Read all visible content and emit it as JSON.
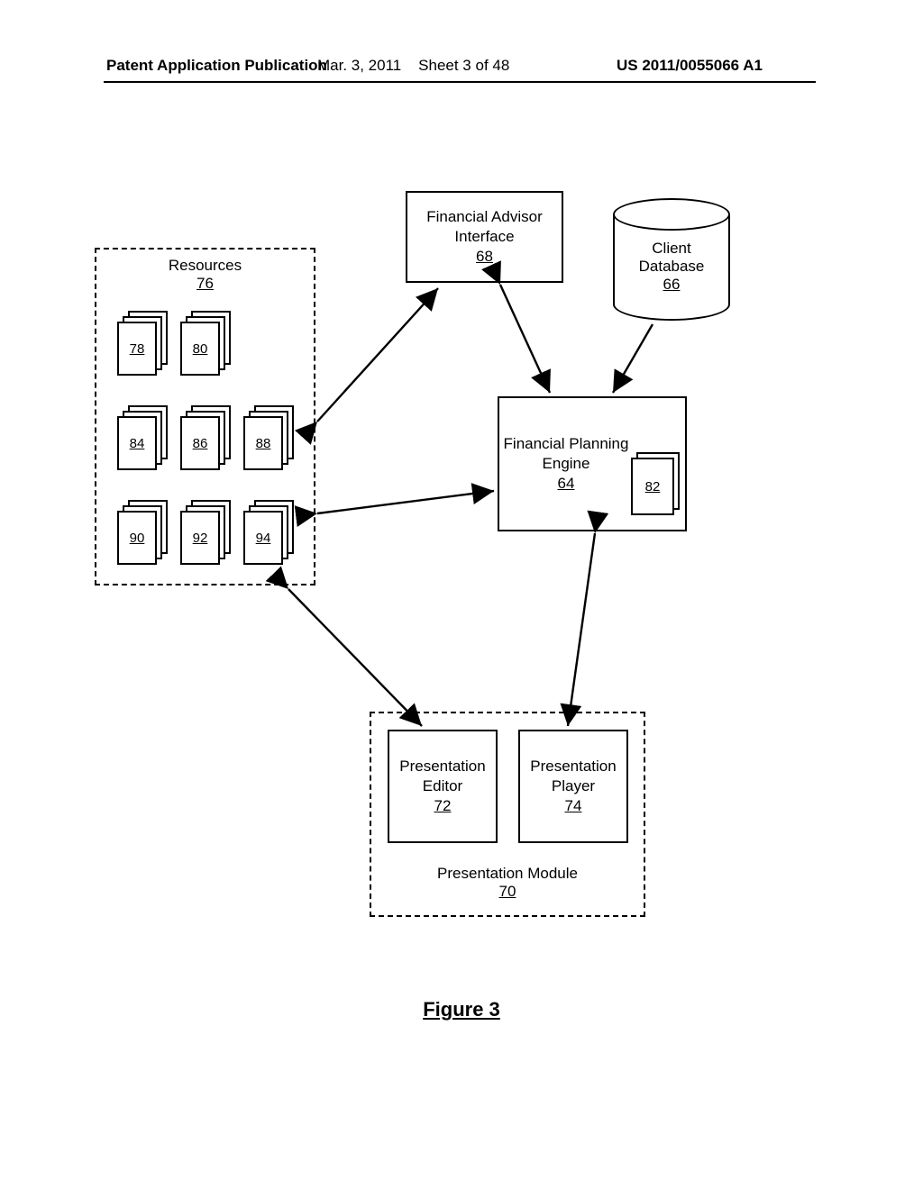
{
  "header": {
    "left": "Patent Application Publication",
    "mid_date": "Mar. 3, 2011",
    "mid_sheet": "Sheet 3 of 48",
    "right": "US 2011/0055066 A1"
  },
  "boxes": {
    "advisor": {
      "title": "Financial Advisor",
      "sub": "Interface",
      "ref": "68"
    },
    "engine": {
      "title": "Financial Planning",
      "sub": "Engine",
      "ref": "64",
      "doc_ref": "82"
    },
    "database": {
      "title": "Client",
      "sub": "Database",
      "ref": "66"
    },
    "resources": {
      "title": "Resources",
      "ref": "76",
      "items": [
        "78",
        "80",
        "84",
        "86",
        "88",
        "90",
        "92",
        "94"
      ]
    },
    "pres_module": {
      "title": "Presentation Module",
      "ref": "70"
    },
    "editor": {
      "title": "Presentation",
      "sub": "Editor",
      "ref": "72"
    },
    "player": {
      "title": "Presentation",
      "sub": "Player",
      "ref": "74"
    }
  },
  "figure_caption": "Figure 3"
}
